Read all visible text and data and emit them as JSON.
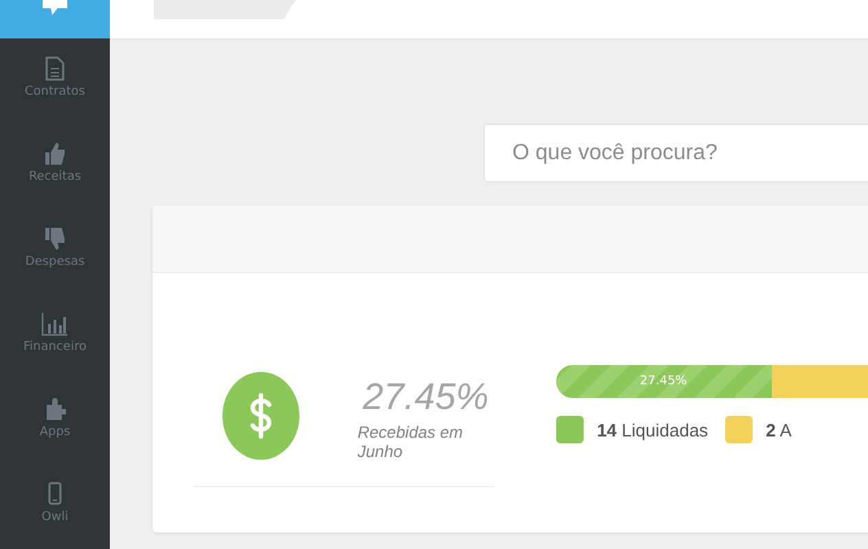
{
  "sidebar": {
    "items": [
      {
        "label": "Contratos",
        "kind": "document"
      },
      {
        "label": "Receitas",
        "kind": "thumbs-up"
      },
      {
        "label": "Despesas",
        "kind": "thumbs-down"
      },
      {
        "label": "Financeiro",
        "kind": "chart"
      },
      {
        "label": "Apps",
        "kind": "puzzle"
      },
      {
        "label": "Owli",
        "kind": "phone"
      }
    ]
  },
  "search": {
    "placeholder": "O que você procura?"
  },
  "summary": {
    "percent": "27.45%",
    "caption": "Recebidas em Junho",
    "bar": {
      "level": 0.2745,
      "label": "27.45%"
    },
    "legend": [
      {
        "count": "14",
        "label": "Liquidadas",
        "color": "#8cc75a"
      },
      {
        "count": "2",
        "label": "A",
        "color": "#f5d05a"
      }
    ]
  }
}
